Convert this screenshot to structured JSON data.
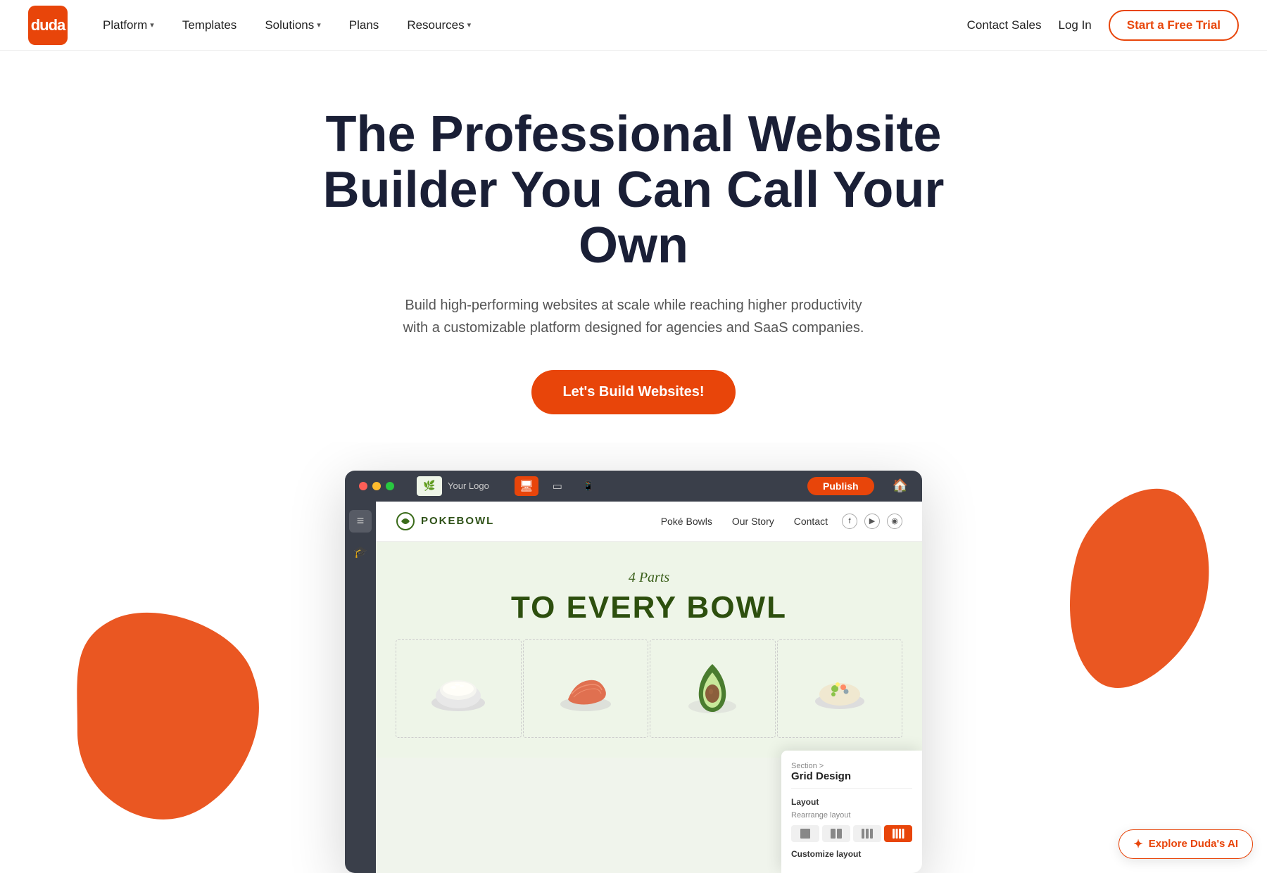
{
  "nav": {
    "logo_text": "duda",
    "links": [
      {
        "label": "Platform",
        "has_dropdown": true
      },
      {
        "label": "Templates",
        "has_dropdown": false
      },
      {
        "label": "Solutions",
        "has_dropdown": true
      },
      {
        "label": "Plans",
        "has_dropdown": false
      },
      {
        "label": "Resources",
        "has_dropdown": true
      }
    ],
    "contact_sales": "Contact Sales",
    "log_in": "Log In",
    "cta": "Start a Free Trial"
  },
  "hero": {
    "heading_line1": "The Professional Website",
    "heading_line2": "Builder You Can Call Your Own",
    "subtext": "Build high-performing websites at scale while reaching higher productivity with a customizable platform designed for agencies and SaaS companies.",
    "cta_label": "Let's Build Websites!"
  },
  "mockup": {
    "browser": {
      "toolbar": {
        "desktop_icon": "🖥",
        "tablet_icon": "⬜",
        "mobile_icon": "📱",
        "home_icon": "🏠"
      },
      "cta_button": "Publish"
    },
    "website": {
      "logo_text": "POKEBOWL",
      "nav_links": [
        "Poké Bowls",
        "Our Story",
        "Contact"
      ],
      "hero_sub": "4 Parts",
      "hero_title": "TO EVERY BOWL",
      "food_items": [
        "rice bowl",
        "salmon",
        "avocado",
        "toppings"
      ]
    },
    "panel": {
      "breadcrumb": "Section >",
      "title": "Grid Design",
      "layout_label": "Layout",
      "rearrange_label": "Rearrange layout",
      "grid_options": [
        "1x1",
        "2x1",
        "3x1",
        "4x1"
      ],
      "customize_label": "Customize layout"
    }
  },
  "explore_ai": {
    "label": "Explore Duda's AI",
    "sparkle": "✦"
  },
  "colors": {
    "orange": "#e8450a",
    "dark_nav": "#1a1f36",
    "light_bg": "#eef5e8",
    "dark_builder": "#3a3f4a"
  }
}
